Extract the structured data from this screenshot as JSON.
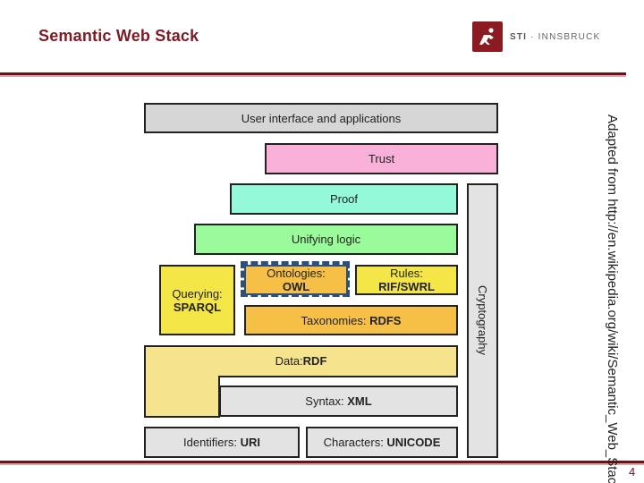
{
  "slide": {
    "title": "Semantic Web Stack",
    "page_number": "4",
    "source_note": "Adapted from http://en.wikipedia.org/wiki/Semantic_Web_Stack"
  },
  "logo": {
    "brand_bold": "STI",
    "separator": " · ",
    "brand_rest": "INNSBRUCK",
    "accent_color": "#8b1a22"
  },
  "stack": {
    "user_interface": "User interface and applications",
    "trust": "Trust",
    "proof": "Proof",
    "unifying_logic": "Unifying logic",
    "querying": {
      "label": "Querying:",
      "tech": "SPARQL"
    },
    "ontologies": {
      "label": "Ontologies:",
      "tech": "OWL"
    },
    "rules": {
      "label": "Rules:",
      "tech": "RIF/SWRL"
    },
    "taxonomies": {
      "label": "Taxonomies: ",
      "tech": "RDFS"
    },
    "data": {
      "label": "Data: ",
      "tech": "RDF"
    },
    "syntax": {
      "label": "Syntax: ",
      "tech": "XML"
    },
    "identifiers": {
      "label": "Identifiers: ",
      "tech": "URI"
    },
    "characters": {
      "label": "Characters: ",
      "tech": "UNICODE"
    },
    "cryptography": "Cryptography"
  },
  "colors": {
    "title": "#7b1c24",
    "highlight_dash": "#2d4f7c"
  }
}
